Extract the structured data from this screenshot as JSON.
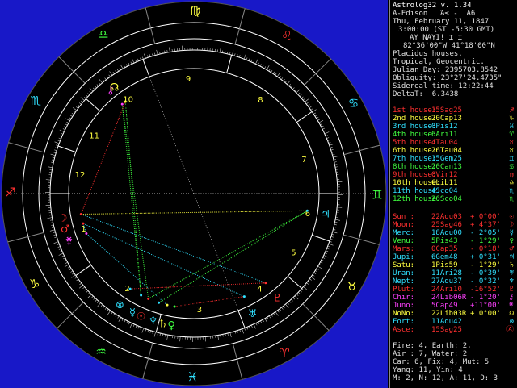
{
  "header": {
    "title": "Astrolog32 v. 1.34",
    "name_line": "A-Edison",
    "name_symbols": "Ά≤ -  Α6",
    "date": "Thu, February 11, 1847",
    "time": "3:00:00 (ST -5:30 GMT)",
    "place_glyphs": "AY NAYI! ⌶ ⌶",
    "coords": "82°36'00\"W 41°18'00\"N",
    "houses": "Placidus houses.",
    "zodiac": "Tropical, Geocentric.",
    "julian": "Julian Day: 2395703.8542",
    "obliquity": "Obliquity: 23°27'24.4735\"",
    "sidereal": "Sidereal time: 12:22:44",
    "deltat": "DeltaT:  6.3438"
  },
  "houses": [
    {
      "label": "1st house:",
      "value": "15Sag25",
      "color": "#ff3030",
      "symbol": "♐"
    },
    {
      "label": "2nd house:",
      "value": "20Cap13",
      "color": "#ffff40",
      "symbol": "♑"
    },
    {
      "label": "3rd house:",
      "value": "0Pis12",
      "color": "#30e0ff",
      "symbol": "♓"
    },
    {
      "label": "4th house:",
      "value": "6Ari11",
      "color": "#40ff40",
      "symbol": "♈"
    },
    {
      "label": "5th house:",
      "value": "4Tau04",
      "color": "#ff3030",
      "symbol": "♉"
    },
    {
      "label": "6th house:",
      "value": "26Tau04",
      "color": "#ffff40",
      "symbol": "♉"
    },
    {
      "label": "7th house:",
      "value": "15Gem25",
      "color": "#30e0ff",
      "symbol": "♊"
    },
    {
      "label": "8th house:",
      "value": "20Can13",
      "color": "#40ff40",
      "symbol": "♋"
    },
    {
      "label": "9th house:",
      "value": "0Vir12",
      "color": "#ff3030",
      "symbol": "♍"
    },
    {
      "label": "10th house:",
      "value": "6Lib11",
      "color": "#ffff40",
      "symbol": "♎"
    },
    {
      "label": "11th house:",
      "value": "4Sco04",
      "color": "#30e0ff",
      "symbol": "♏"
    },
    {
      "label": "12th house:",
      "value": "26Sco04",
      "color": "#40ff40",
      "symbol": "♏"
    }
  ],
  "planets": [
    {
      "label": "Sun :",
      "value": "22Aqu03",
      "lat": "+ 0°00'",
      "color": "#ff3030",
      "symbol": "☉"
    },
    {
      "label": "Moon:",
      "value": "25Sag46",
      "lat": "+ 4°37'",
      "color": "#ff3030",
      "symbol": "☽"
    },
    {
      "label": "Merc:",
      "value": "18Aqu00",
      "lat": "- 2°05'",
      "color": "#30e0ff",
      "symbol": "☿"
    },
    {
      "label": "Venu:",
      "value": "5Pis43",
      "lat": "- 1°29'",
      "color": "#40ff40",
      "symbol": "♀"
    },
    {
      "label": "Mars:",
      "value": "0Cap35",
      "lat": "- 0°18'",
      "color": "#ff3030",
      "symbol": "♂"
    },
    {
      "label": "Jupi:",
      "value": "6Gem48",
      "lat": "+ 0°31'",
      "color": "#30e0ff",
      "symbol": "♃"
    },
    {
      "label": "Satu:",
      "value": "1Pis59",
      "lat": "- 1°29'",
      "color": "#ffff40",
      "symbol": "♄"
    },
    {
      "label": "Uran:",
      "value": "11Ari28",
      "lat": "- 0°39'",
      "color": "#30e0ff",
      "symbol": "♅"
    },
    {
      "label": "Nept:",
      "value": "27Aqu37",
      "lat": "- 0°32'",
      "color": "#30e0ff",
      "symbol": "♆"
    },
    {
      "label": "Plut:",
      "value": "24Ari10",
      "lat": "-16°52'",
      "color": "#ff3030",
      "symbol": "♇"
    },
    {
      "label": "Chir:",
      "value": "24Lib06R",
      "lat": "- 1°20'",
      "color": "#ff40ff",
      "symbol": "⚷"
    },
    {
      "label": "Juno:",
      "value": "5Cap49",
      "lat": "+11°00'",
      "color": "#ff40ff",
      "symbol": "⚵"
    },
    {
      "label": "NoNo:",
      "value": "22Lib03R",
      "lat": "+ 0°00'",
      "color": "#ffff40",
      "symbol": "☊"
    },
    {
      "label": "Fort:",
      "value": "11Aqu42",
      "lat": "",
      "color": "#30e0ff",
      "symbol": "⊗"
    },
    {
      "label": "Asce:",
      "value": "15Sag25",
      "lat": "",
      "color": "#ff3030",
      "symbol": "Ⓐ"
    }
  ],
  "summary": {
    "elements1": "Fire: 4, Earth: 2,",
    "elements2": "Air : 7, Water: 2",
    "modes": "Car: 6, Fix: 4, Mut: 5",
    "yang": "Yang: 11, Yin: 4",
    "quads": "M: 2, N: 12, A: 11, D: 3"
  },
  "wheel": {
    "house_numbers": [
      "1",
      "2",
      "3",
      "4",
      "5",
      "6",
      "7",
      "8",
      "9",
      "10",
      "11",
      "12"
    ],
    "sign_glyphs": [
      "♈",
      "♉",
      "♊",
      "♋",
      "♌",
      "♍",
      "♎",
      "♏",
      "♐",
      "♑",
      "♒",
      "♓"
    ],
    "colors": {
      "bg": "#1818c8",
      "circle": "#000000",
      "ring": "#ffffff",
      "fire": "#ff3030",
      "earth": "#ffff40",
      "air": "#40ff40",
      "water": "#30e0ff"
    }
  }
}
